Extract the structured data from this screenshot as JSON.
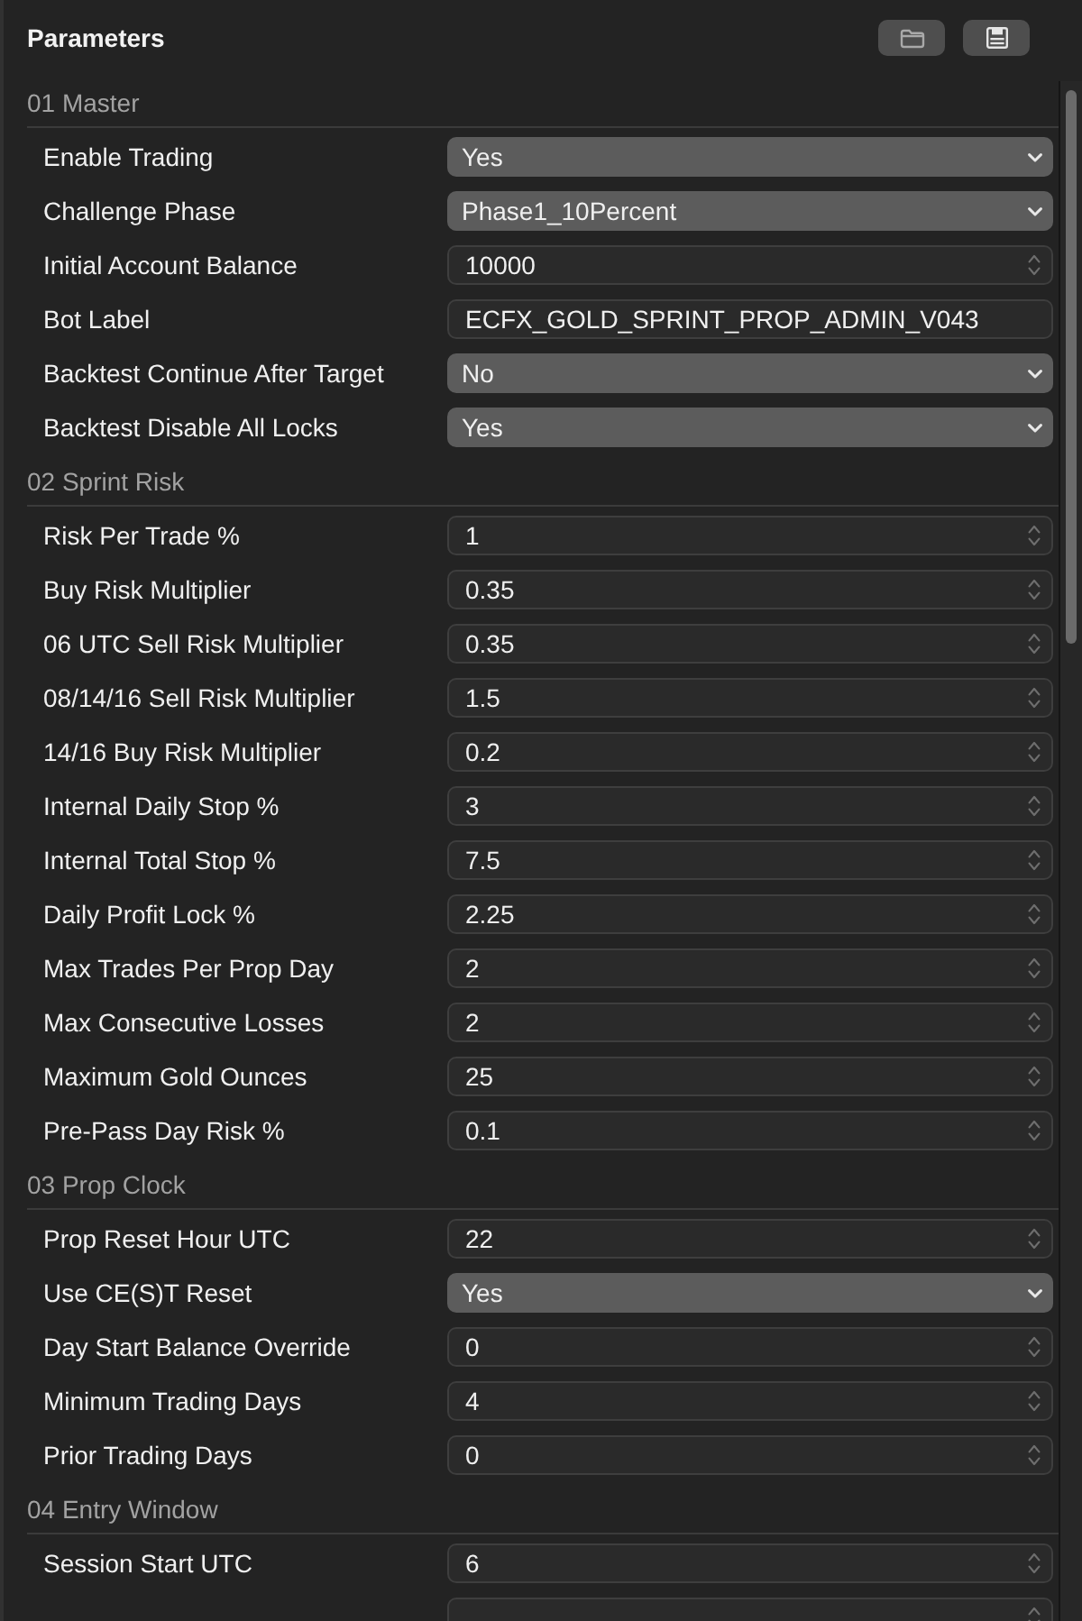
{
  "panel": {
    "title": "Parameters"
  },
  "sections": [
    {
      "title": "01 Master",
      "params": [
        {
          "label": "Enable Trading",
          "kind": "select",
          "value": "Yes"
        },
        {
          "label": "Challenge Phase",
          "kind": "select",
          "value": "Phase1_10Percent"
        },
        {
          "label": "Initial Account Balance",
          "kind": "number",
          "value": "10000"
        },
        {
          "label": "Bot Label",
          "kind": "text",
          "value": "ECFX_GOLD_SPRINT_PROP_ADMIN_V043"
        },
        {
          "label": "Backtest Continue After Target",
          "kind": "select",
          "value": "No"
        },
        {
          "label": "Backtest Disable All Locks",
          "kind": "select",
          "value": "Yes"
        }
      ]
    },
    {
      "title": "02 Sprint Risk",
      "params": [
        {
          "label": "Risk Per Trade %",
          "kind": "number",
          "value": "1"
        },
        {
          "label": "Buy Risk Multiplier",
          "kind": "number",
          "value": "0.35"
        },
        {
          "label": "06 UTC Sell Risk Multiplier",
          "kind": "number",
          "value": "0.35"
        },
        {
          "label": "08/14/16 Sell Risk Multiplier",
          "kind": "number",
          "value": "1.5"
        },
        {
          "label": "14/16 Buy Risk Multiplier",
          "kind": "number",
          "value": "0.2"
        },
        {
          "label": "Internal Daily Stop %",
          "kind": "number",
          "value": "3"
        },
        {
          "label": "Internal Total Stop %",
          "kind": "number",
          "value": "7.5"
        },
        {
          "label": "Daily Profit Lock %",
          "kind": "number",
          "value": "2.25"
        },
        {
          "label": "Max Trades Per Prop Day",
          "kind": "number",
          "value": "2"
        },
        {
          "label": "Max Consecutive Losses",
          "kind": "number",
          "value": "2"
        },
        {
          "label": "Maximum Gold Ounces",
          "kind": "number",
          "value": "25"
        },
        {
          "label": "Pre-Pass Day Risk %",
          "kind": "number",
          "value": "0.1"
        }
      ]
    },
    {
      "title": "03 Prop Clock",
      "params": [
        {
          "label": "Prop Reset Hour UTC",
          "kind": "number",
          "value": "22"
        },
        {
          "label": "Use CE(S)T Reset",
          "kind": "select",
          "value": "Yes"
        },
        {
          "label": "Day Start Balance Override",
          "kind": "number",
          "value": "0"
        },
        {
          "label": "Minimum Trading Days",
          "kind": "number",
          "value": "4"
        },
        {
          "label": "Prior Trading Days",
          "kind": "number",
          "value": "0"
        }
      ]
    },
    {
      "title": "04 Entry Window",
      "params": [
        {
          "label": "Session Start UTC",
          "kind": "number",
          "value": "6"
        },
        {
          "kind": "number"
        }
      ]
    }
  ]
}
